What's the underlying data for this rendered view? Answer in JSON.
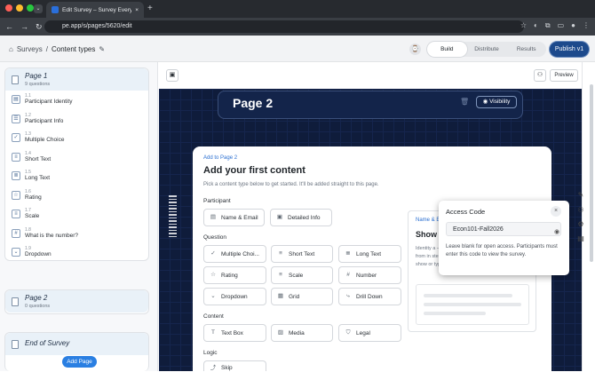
{
  "browser": {
    "tab_title": "Edit Survey – Survey Everyw",
    "new_tab": "+",
    "url": "pe.app/s/pages/5620/edit",
    "nav_back": "←",
    "nav_forward": "→",
    "nav_reload": "↻",
    "dropdown": "⌄",
    "close": "×"
  },
  "colors": {
    "close": "#ff5f57",
    "min": "#febc2e",
    "max": "#28c840",
    "accent": "#1d4a8c",
    "canvas": "#0f1c3b"
  },
  "header": {
    "breadcrumb_root": "Surveys",
    "breadcrumb_sep": "/",
    "breadcrumb_current": "Content types",
    "tabs": [
      "Build",
      "Distribute",
      "Results"
    ],
    "active_tab": "Build",
    "publish": "Publish v1"
  },
  "sidebar": {
    "page1": {
      "title": "Page 1",
      "subtitle": "9 questions"
    },
    "questions": [
      {
        "num": "1.1",
        "label": "Participant Identity",
        "icon": "id-icon",
        "glyph": "▤"
      },
      {
        "num": "1.2",
        "label": "Participant Info",
        "icon": "contact-icon",
        "glyph": "☰"
      },
      {
        "num": "1.3",
        "label": "Multiple Choice",
        "icon": "check-circle-icon",
        "glyph": "✓"
      },
      {
        "num": "1.4",
        "label": "Short Text",
        "icon": "short-text-icon",
        "glyph": "≡"
      },
      {
        "num": "1.5",
        "label": "Long Text",
        "icon": "long-text-icon",
        "glyph": "≣"
      },
      {
        "num": "1.6",
        "label": "Rating",
        "icon": "star-icon",
        "glyph": "☆"
      },
      {
        "num": "1.7",
        "label": "Scale",
        "icon": "scale-icon",
        "glyph": "≡"
      },
      {
        "num": "1.8",
        "label": "What is the number?",
        "icon": "number-icon",
        "glyph": "#"
      },
      {
        "num": "1.9",
        "label": "Dropdown",
        "icon": "dropdown-icon",
        "glyph": "⌄"
      }
    ],
    "page2": {
      "title": "Page 2",
      "subtitle": "0 questions"
    },
    "end": {
      "title": "End of Survey"
    },
    "add_page": "Add Page"
  },
  "canvas": {
    "preview": "Preview",
    "page_title": "Page 2",
    "visibility": "Visibility"
  },
  "content": {
    "add_to": "Add to Page 2",
    "title": "Add your first content",
    "subtitle": "Pick a content type below to get started. It'll be added straight to this page.",
    "participant": "Participant",
    "question": "Question",
    "content_section": "Content",
    "logic": "Logic",
    "chips": {
      "name_email": "Name & Email",
      "detailed_info": "Detailed Info",
      "multiple_choice": "Multiple Choi...",
      "short_text": "Short Text",
      "long_text": "Long Text",
      "rating": "Rating",
      "scale": "Scale",
      "number": "Number",
      "dropdown": "Dropdown",
      "grid": "Grid",
      "drill_down": "Drill Down",
      "text_box": "Text Box",
      "media": "Media",
      "legal": "Legal",
      "skip": "Skip"
    }
  },
  "preview_card": {
    "head": "Name & E",
    "title": "Show c",
    "body": "Identity a — from in step show or type it"
  },
  "popover": {
    "title": "Access Code",
    "value": "Econ101-Fall2026",
    "help": "Leave blank for open access. Participants must enter this code to view the survey."
  }
}
